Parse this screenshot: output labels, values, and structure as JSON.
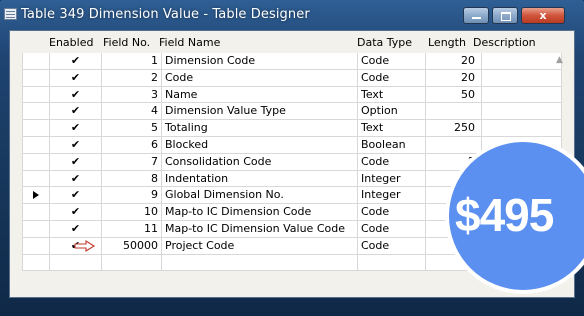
{
  "window": {
    "title": "Table 349 Dimension Value - Table Designer",
    "close_label": "x"
  },
  "columns": {
    "enabled": "Enabled",
    "field_no": "Field No.",
    "field_name": "Field Name",
    "data_type": "Data Type",
    "length": "Length",
    "description": "Description"
  },
  "rows": [
    {
      "enabled": "✔",
      "field_no": "1",
      "field_name": "Dimension Code",
      "data_type": "Code",
      "length": "20",
      "description": ""
    },
    {
      "enabled": "✔",
      "field_no": "2",
      "field_name": "Code",
      "data_type": "Code",
      "length": "20",
      "description": ""
    },
    {
      "enabled": "✔",
      "field_no": "3",
      "field_name": "Name",
      "data_type": "Text",
      "length": "50",
      "description": ""
    },
    {
      "enabled": "✔",
      "field_no": "4",
      "field_name": "Dimension Value Type",
      "data_type": "Option",
      "length": "",
      "description": ""
    },
    {
      "enabled": "✔",
      "field_no": "5",
      "field_name": "Totaling",
      "data_type": "Text",
      "length": "250",
      "description": ""
    },
    {
      "enabled": "✔",
      "field_no": "6",
      "field_name": "Blocked",
      "data_type": "Boolean",
      "length": "",
      "description": ""
    },
    {
      "enabled": "✔",
      "field_no": "7",
      "field_name": "Consolidation Code",
      "data_type": "Code",
      "length": "2",
      "description": ""
    },
    {
      "enabled": "✔",
      "field_no": "8",
      "field_name": "Indentation",
      "data_type": "Integer",
      "length": "",
      "description": ""
    },
    {
      "enabled": "✔",
      "field_no": "9",
      "field_name": "Global Dimension No.",
      "data_type": "Integer",
      "length": "",
      "description": ""
    },
    {
      "enabled": "✔",
      "field_no": "10",
      "field_name": "Map-to IC Dimension Code",
      "data_type": "Code",
      "length": "",
      "description": ""
    },
    {
      "enabled": "✔",
      "field_no": "11",
      "field_name": "Map-to IC Dimension Value Code",
      "data_type": "Code",
      "length": "",
      "description": ""
    },
    {
      "enabled": "✔",
      "field_no": "50000",
      "field_name": "Project Code",
      "data_type": "Code",
      "length": "",
      "description": ""
    },
    {
      "enabled": "",
      "field_no": "",
      "field_name": "",
      "data_type": "",
      "length": "",
      "description": ""
    }
  ],
  "current_row_index": 8,
  "highlighted_row_index": 11,
  "price_badge": {
    "text": "$495",
    "color": "#5b8ff0"
  }
}
